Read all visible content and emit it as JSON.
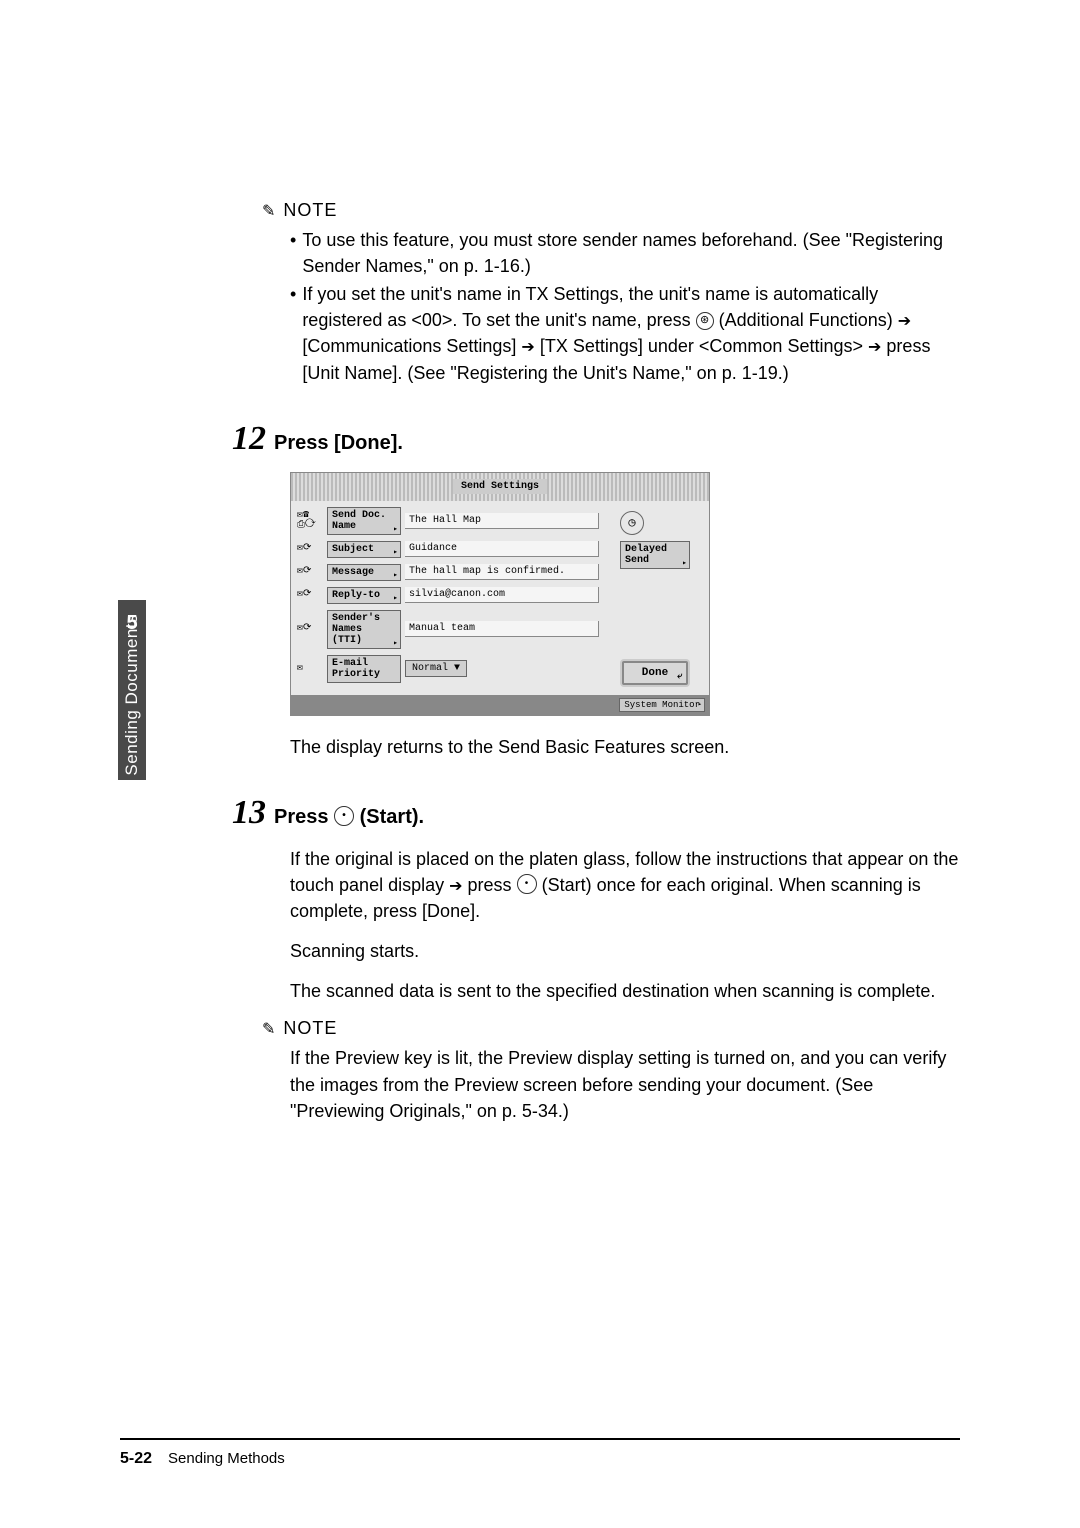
{
  "side_tab": {
    "number": "5",
    "label": "Sending Documents"
  },
  "note1": {
    "label": "NOTE",
    "bullet1": "To use this feature, you must store sender names beforehand. (See \"Registering Sender Names,\" on p. 1-16.)",
    "bullet2_a": "If you set the unit's name in TX Settings, the unit's name is automatically registered as <00>. To set the unit's name, press ",
    "bullet2_icon": "⊛",
    "bullet2_b": " (Additional Functions) ",
    "bullet2_c": " [Communications Settings] ",
    "bullet2_d": " [TX Settings] under <Common Settings> ",
    "bullet2_e": " press [Unit Name]. (See \"Registering the Unit's Name,\" on p. 1-19.)"
  },
  "step12": {
    "num": "12",
    "title": "Press [Done]."
  },
  "screen": {
    "header": "Send\nSettings",
    "rows": {
      "doc_name": {
        "btn": "Send Doc.\nName",
        "val": "The Hall Map"
      },
      "subject": {
        "btn": "Subject",
        "val": "Guidance"
      },
      "message": {
        "btn": "Message",
        "val": "The hall map is confirmed."
      },
      "reply": {
        "btn": "Reply-to",
        "val": "silvia@canon.com"
      },
      "sender": {
        "btn": "Sender's\nNames (TTI)",
        "val": "Manual team"
      },
      "priority": {
        "label": "E-mail\nPriority",
        "val": "Normal"
      }
    },
    "right": {
      "delayed": "Delayed\nSend",
      "done": "Done"
    },
    "footer": "System Monitor"
  },
  "post12": "The display returns to the Send Basic Features screen.",
  "step13": {
    "num": "13",
    "title_a": "Press ",
    "title_b": " (Start)."
  },
  "body13_a": "If the original is placed on the platen glass, follow the instructions that appear on the touch panel display ",
  "body13_b": " press ",
  "body13_c": " (Start) once for each original. When scanning is complete, press [Done].",
  "body13_d": "Scanning starts.",
  "body13_e": "The scanned data is sent to the specified destination when scanning is complete.",
  "note2": {
    "label": "NOTE",
    "text": "If the Preview key is lit, the Preview display setting is turned on, and you can verify the images from the Preview screen before sending your document. (See \"Previewing Originals,\" on p. 5-34.)"
  },
  "footer": {
    "page": "5-22",
    "section": "Sending Methods"
  }
}
